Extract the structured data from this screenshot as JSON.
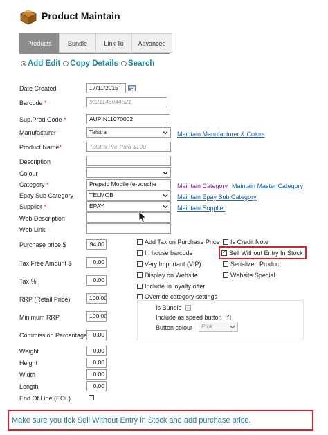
{
  "header": {
    "title": "Product Maintain",
    "icon": "box-icon"
  },
  "tabs": [
    {
      "label": "Products",
      "active": true
    },
    {
      "label": "Bundle",
      "active": false
    },
    {
      "label": "Link To",
      "active": false
    },
    {
      "label": "Advanced",
      "active": false
    }
  ],
  "mode": {
    "add_edit": "Add Edit",
    "copy_details": "Copy Details",
    "search": "Search",
    "selected": "Add Edit"
  },
  "form": {
    "date_created": {
      "label": "Date Created",
      "value": "17/11/2015"
    },
    "barcode": {
      "label": "Barcode",
      "required": "*",
      "placeholder": "9321146044521"
    },
    "sup_prod_code": {
      "label": "Sup.Prod.Code",
      "required": "*",
      "value": "AUPIN11070002"
    },
    "manufacturer": {
      "label": "Manufacturer",
      "value": "Telstra",
      "link": "Maintain Manufacturer & Colors"
    },
    "product_name": {
      "label": "Product Name",
      "required": "*",
      "placeholder": "Telstra Pre-Paid $100"
    },
    "description": {
      "label": "Description",
      "value": ""
    },
    "colour": {
      "label": "Colour",
      "value": ""
    },
    "category": {
      "label": "Category",
      "required": "*",
      "value": "Prepaid Mobile (e-vouche",
      "link1": "Maintain Category",
      "link2": "Maintain Master Category"
    },
    "epay_sub_category": {
      "label": "Epay Sub Category",
      "value": "TELMOB",
      "link": "Maintain Epay Sub Category"
    },
    "supplier": {
      "label": "Supplier",
      "required": "*",
      "value": "EPAY",
      "link": "Maintain Supplier"
    },
    "web_description": {
      "label": "Web Description",
      "value": ""
    },
    "web_link": {
      "label": "Web Link",
      "value": ""
    },
    "purchase_price": {
      "label": "Purchase price $",
      "value": "94.00"
    },
    "tax_free_amount": {
      "label": "Tax Free Amount $",
      "value": "0.00"
    },
    "tax_pct": {
      "label": "Tax %",
      "value": "0.00"
    },
    "rrp": {
      "label": "RRP (Retail Price)",
      "value": "100.00"
    },
    "minimum_rrp": {
      "label": "Minimum RRP",
      "value": "100.00"
    },
    "commission_percentage": {
      "label": "Commission Percentage",
      "value": "0.00"
    },
    "weight": {
      "label": "Weight",
      "value": "0.00"
    },
    "height": {
      "label": "Height",
      "value": "0.00"
    },
    "width": {
      "label": "Width",
      "value": "0.00"
    },
    "length": {
      "label": "Length",
      "value": "0.00"
    },
    "end_of_line": {
      "label": "End Of Line (EOL)",
      "checked": false
    }
  },
  "options": {
    "add_tax_on_purchase_price": {
      "label": "Add Tax on Purchase Price",
      "checked": false
    },
    "is_credit_note": {
      "label": "Is Credit Note",
      "checked": false
    },
    "in_house_barcode": {
      "label": "In house barcode",
      "checked": false
    },
    "sell_without_entry_in_stock": {
      "label": "Sell Without Entry In Stock",
      "checked": true
    },
    "very_important": {
      "label": "Very Important (VIP)",
      "checked": false
    },
    "serialized_product": {
      "label": "Serialized Product",
      "checked": false
    },
    "display_on_website": {
      "label": "Display on Website",
      "checked": false
    },
    "website_special": {
      "label": "Website Special",
      "checked": false
    },
    "include_in_loyalty_offer": {
      "label": "Include In loyalty offer",
      "checked": false
    },
    "override_category_settings": {
      "label": "Override category settings",
      "checked": false
    },
    "is_bundle": {
      "label": "Is Bundle",
      "checked": false
    },
    "include_as_speed_button": {
      "label": "Include as speed button",
      "checked": true
    },
    "button_colour": {
      "label": "Button colour",
      "value": "Pink"
    }
  },
  "note": "Make sure you tick Sell Without Entry in Stock and add purchase price.",
  "colors": {
    "accent": "#1b8aa6",
    "link": "#1a5fb4",
    "highlight": "#d8232a",
    "tab_active": "#8c8c8c"
  }
}
